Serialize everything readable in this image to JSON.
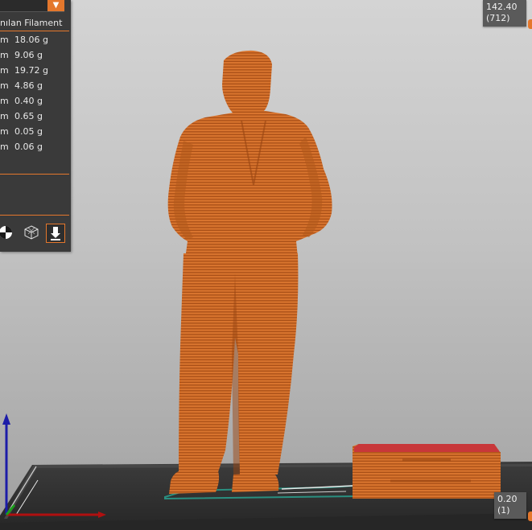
{
  "legend": {
    "header": "nılan Filament",
    "rows": [
      {
        "unit": "m",
        "weight": "18.06 g"
      },
      {
        "unit": "m",
        "weight": "9.06 g"
      },
      {
        "unit": "m",
        "weight": "19.72 g"
      },
      {
        "unit": "m",
        "weight": "4.86 g"
      },
      {
        "unit": "m",
        "weight": "0.40 g"
      },
      {
        "unit": "m",
        "weight": "0.65 g"
      },
      {
        "unit": "m",
        "weight": "0.05 g"
      },
      {
        "unit": "m",
        "weight": "0.06 g"
      }
    ]
  },
  "slider": {
    "top_value": "142.40",
    "top_layer": "(712)",
    "bottom_value": "0.20",
    "bottom_layer": "(1)"
  },
  "colors": {
    "accent": "#e4772c",
    "model": "#d8742e",
    "panel": "#3a3a3a",
    "bed": "#2f2f2f"
  },
  "icons": [
    "dropdown-arrow-icon",
    "view-shaded-icon",
    "view-wireframe-icon",
    "view-export-icon"
  ]
}
